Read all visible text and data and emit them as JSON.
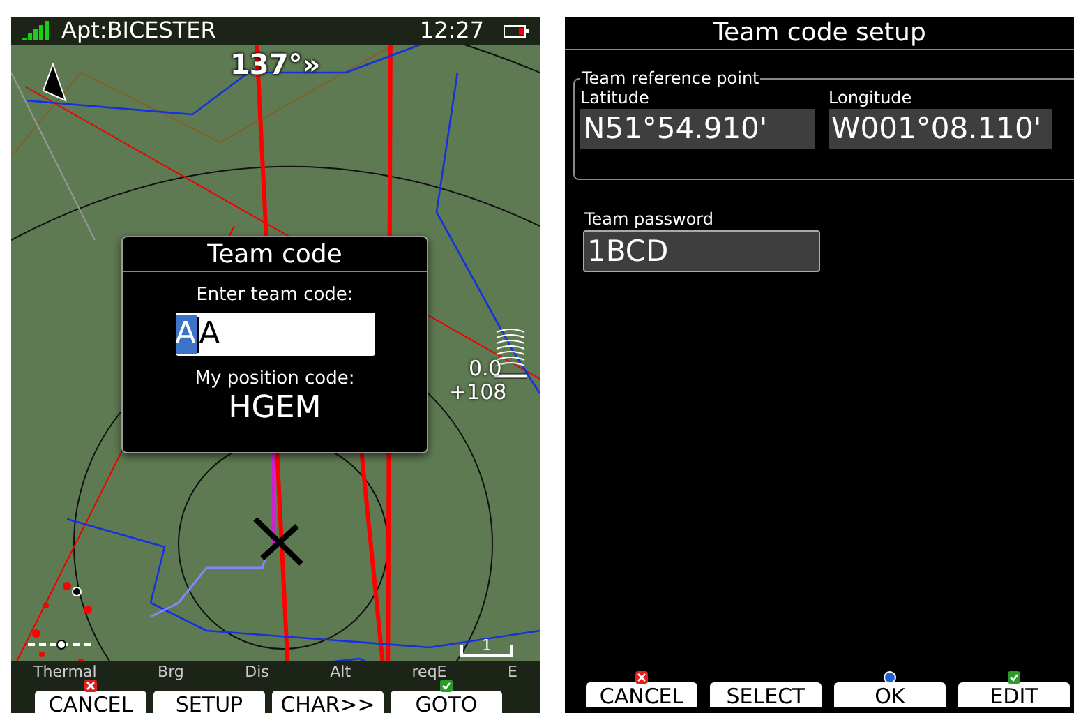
{
  "map_screen": {
    "status_bar": {
      "waypoint": "Apt:BICESTER",
      "time": "12:27"
    },
    "track": "137°»",
    "vario": {
      "value": "0.0",
      "altitude": "+108"
    },
    "scale": "1",
    "dialog": {
      "title": "Team code",
      "prompt": "Enter team code:",
      "value_highlighted": "A",
      "value_rest": "A",
      "position_label": "My position code:",
      "position_code": "HGEM"
    },
    "nav_labels": [
      "Thermal",
      "Brg",
      "Dis",
      "Alt",
      "reqE",
      "E"
    ],
    "buttons": [
      {
        "label": "CANCEL",
        "kind": "cancel"
      },
      {
        "label": "SETUP",
        "kind": "plain"
      },
      {
        "label": "CHAR>>",
        "kind": "plain"
      },
      {
        "label": "GOTO",
        "kind": "confirm"
      }
    ]
  },
  "setup_screen": {
    "title": "Team code setup",
    "reference_point": {
      "legend": "Team reference point",
      "latitude_label": "Latitude",
      "latitude": "N51°54.910'",
      "longitude_label": "Longitude",
      "longitude": "W001°08.110'"
    },
    "password": {
      "label": "Team password",
      "value": "1BCD"
    },
    "buttons": [
      {
        "label": "CANCEL",
        "kind": "cancel"
      },
      {
        "label": "SELECT",
        "kind": "plain"
      },
      {
        "label": "OK",
        "kind": "ok"
      },
      {
        "label": "EDIT",
        "kind": "confirm"
      }
    ]
  }
}
